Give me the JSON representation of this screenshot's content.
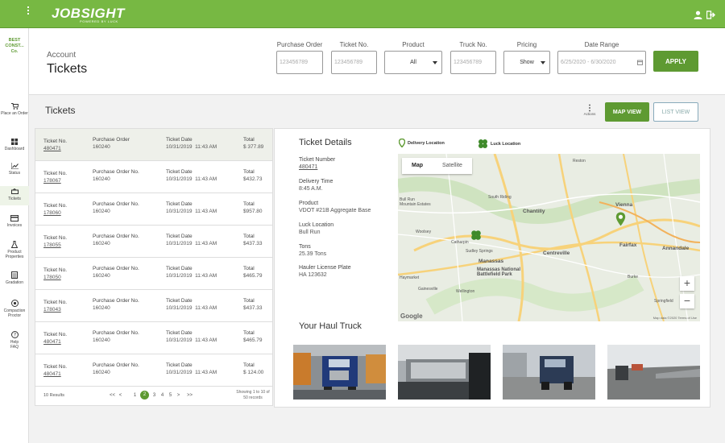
{
  "app": {
    "logo": "JOBSIGHT",
    "logo_sub": "POWERED BY LUCK",
    "company": "BEST CONST... Co."
  },
  "colors": {
    "brand": "#77b843",
    "brand_dark": "#5e9a32"
  },
  "top_icons": [
    "user-icon",
    "sign-out-icon"
  ],
  "sidebar": {
    "items": [
      {
        "label": "Place an Order",
        "icon": "cart-icon"
      },
      {
        "label": "Dashboard",
        "icon": "dashboard-icon"
      },
      {
        "label": "Status",
        "icon": "chart-icon"
      },
      {
        "label": "Tickets",
        "icon": "ticket-icon"
      },
      {
        "label": "Invoices",
        "icon": "invoice-icon"
      },
      {
        "label": "Product Properties",
        "icon": "flask-icon"
      },
      {
        "label": "Gradation",
        "icon": "gradation-icon"
      },
      {
        "label": "Compaction Proctor",
        "icon": "target-icon"
      },
      {
        "label": "Help FAQ",
        "icon": "help-icon"
      }
    ]
  },
  "header": {
    "account_label": "Account",
    "page_title": "Tickets",
    "filters": {
      "purchase_order": {
        "label": "Purchase Order",
        "placeholder": "123456789"
      },
      "ticket_no": {
        "label": "Ticket No.",
        "placeholder": "123456789"
      },
      "product": {
        "label": "Product",
        "value": "All"
      },
      "truck_no": {
        "label": "Truck No.",
        "placeholder": "123456789"
      },
      "pricing": {
        "label": "Pricing",
        "value": "Show"
      },
      "date_range": {
        "label": "Date Range",
        "placeholder": "6/25/2020 - 6/30/2020"
      }
    },
    "apply_label": "APPLY"
  },
  "main": {
    "section_title": "Tickets",
    "actions_label": "Actions",
    "map_view_label": "MAP VIEW",
    "list_view_label": "LIST VIEW"
  },
  "ticket_list": {
    "headers": {
      "ticket_no": "Ticket No.",
      "purchase_order": "Purchase Order",
      "purchase_order_no": "Purchase Order No.",
      "ticket_date": "Ticket Date",
      "total": "Total"
    },
    "rows": [
      {
        "ticket_no": "480471",
        "po": "160240",
        "date": "10/31/2019",
        "time": "11:43 AM",
        "total": "$ 377.89",
        "selected": true
      },
      {
        "ticket_no": "178067",
        "po": "160240",
        "date": "10/31/2019",
        "time": "11:43 AM",
        "total": "$432.73"
      },
      {
        "ticket_no": "178060",
        "po": "160240",
        "date": "10/31/2019",
        "time": "11:43 AM",
        "total": "$957.80"
      },
      {
        "ticket_no": "178055",
        "po": "160240",
        "date": "10/31/2019",
        "time": "11:43 AM",
        "total": "$437.33"
      },
      {
        "ticket_no": "178050",
        "po": "160240",
        "date": "10/31/2019",
        "time": "11:43 AM",
        "total": "$465.79"
      },
      {
        "ticket_no": "178043",
        "po": "160240",
        "date": "10/31/2019",
        "time": "11:43 AM",
        "total": "$437.33"
      },
      {
        "ticket_no": "480471",
        "po": "160240",
        "date": "10/31/2019",
        "time": "11:43 AM",
        "total": "$465.79"
      },
      {
        "ticket_no": "480471",
        "po": "160240",
        "date": "10/31/2019",
        "time": "11:43 AM",
        "total": "$ 124.00"
      }
    ],
    "results": "10 Results",
    "pager": [
      "<<",
      "<",
      "1",
      "2",
      "3",
      "4",
      "5",
      ">",
      ">>"
    ],
    "current_page": "2",
    "showing": "Showing 1 to 10 of 50 records"
  },
  "detail": {
    "title": "Ticket Details",
    "delivery_location": "Delivery Location",
    "luck_location_legend": "Luck Location",
    "fields": [
      {
        "label": "Ticket Number",
        "value": "480471",
        "link": true
      },
      {
        "label": "Delivery Time",
        "value": "8:45 A.M."
      },
      {
        "label": "Product",
        "value": "VDOT #21B Aggregate Base"
      },
      {
        "label": "Luck Location",
        "value": "Bull Run"
      },
      {
        "label": "Tons",
        "value": "25.39 Tons"
      },
      {
        "label": "Hauler License Plate",
        "value": "HA 123632"
      }
    ],
    "haul_title": "Your Haul Truck"
  },
  "map": {
    "tab_map": "Map",
    "tab_satellite": "Satellite",
    "zoom_in": "+",
    "zoom_out": "−",
    "google": "Google",
    "credit": "Map data ©2020    Terms of Use",
    "places": [
      "Reston",
      "Bull Run Mountain Estates",
      "South Riding",
      "Chantilly",
      "Centreville",
      "Vienna",
      "Fairfax",
      "Annandale",
      "Manassas",
      "Manassas National Battlefield Park",
      "Burke",
      "Haymarket",
      "Gainesville",
      "Woolsey",
      "Catharpin",
      "Sudley Springs",
      "Springfield",
      "Wellington"
    ]
  }
}
